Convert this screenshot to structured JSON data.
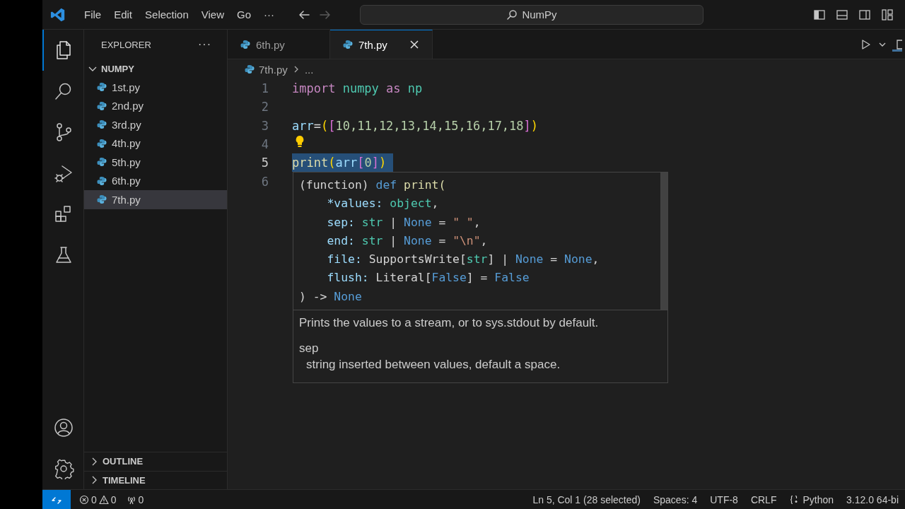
{
  "title_bar": {
    "menu": [
      "File",
      "Edit",
      "Selection",
      "View",
      "Go",
      "···"
    ],
    "nav": [
      {
        "kind": "back",
        "disabled": false
      },
      {
        "kind": "forward",
        "disabled": true
      }
    ],
    "search": "NumPy"
  },
  "activity_bar": {
    "top": [
      {
        "kind": "files",
        "selected": true
      },
      {
        "kind": "search",
        "selected": false
      },
      {
        "kind": "source-control",
        "selected": false
      },
      {
        "kind": "run-debug",
        "selected": false
      },
      {
        "kind": "extensions",
        "selected": false
      },
      {
        "kind": "testing",
        "selected": false
      }
    ],
    "bottom": [
      {
        "kind": "account",
        "selected": false
      },
      {
        "kind": "settings",
        "selected": false
      }
    ]
  },
  "sidebar": {
    "title": "EXPLORER",
    "more": "···",
    "folder": {
      "name": "NUMPY",
      "expanded": true,
      "files": [
        {
          "name": "1st.py",
          "selected": false
        },
        {
          "name": "2nd.py",
          "selected": false
        },
        {
          "name": "3rd.py",
          "selected": false
        },
        {
          "name": "4th.py",
          "selected": false
        },
        {
          "name": "5th.py",
          "selected": false
        },
        {
          "name": "6th.py",
          "selected": false
        },
        {
          "name": "7th.py",
          "selected": true
        }
      ]
    },
    "sections": [
      {
        "name": "OUTLINE",
        "expanded": false
      },
      {
        "name": "TIMELINE",
        "expanded": false
      }
    ]
  },
  "tabs": [
    {
      "label": "6th.py",
      "selected": false
    },
    {
      "label": "7th.py",
      "selected": true
    }
  ],
  "breadcrumb": {
    "file": "7th.py",
    "rest": "..."
  },
  "editor": {
    "lines": [
      {
        "number": "1",
        "current": false,
        "selected": false,
        "lightbulb": false,
        "tokens": [
          {
            "t": "import ",
            "kind": "keyword"
          },
          {
            "t": "numpy ",
            "kind": "module"
          },
          {
            "t": "as ",
            "kind": "keyword"
          },
          {
            "t": "np",
            "kind": "module"
          }
        ]
      },
      {
        "number": "2",
        "current": false,
        "selected": false,
        "lightbulb": false
      },
      {
        "number": "3",
        "current": false,
        "selected": false,
        "lightbulb": false,
        "tokens": [
          {
            "t": "arr",
            "kind": "var"
          },
          {
            "t": "=",
            "kind": "plain"
          },
          {
            "t": "(",
            "kind": "bracket1"
          },
          {
            "t": "[",
            "kind": "bracket2"
          },
          {
            "t": "10,11,12,13,14,15,16,17,18",
            "kind": "number"
          },
          {
            "t": "]",
            "kind": "bracket2"
          },
          {
            "t": ")",
            "kind": "bracket1"
          }
        ]
      },
      {
        "number": "4",
        "current": false,
        "selected": false,
        "lightbulb": true
      },
      {
        "number": "5",
        "current": true,
        "selected": true,
        "lightbulb": false,
        "tokens": [
          {
            "t": "print",
            "kind": "func"
          },
          {
            "t": "(",
            "kind": "bracket1"
          },
          {
            "t": "arr",
            "kind": "var"
          },
          {
            "t": "[",
            "kind": "bracket2"
          },
          {
            "t": "0",
            "kind": "number"
          },
          {
            "t": "]",
            "kind": "bracket2"
          },
          {
            "t": ")",
            "kind": "bracket1"
          }
        ]
      },
      {
        "number": "6",
        "current": false,
        "selected": false,
        "lightbulb": false
      }
    ]
  },
  "hover": {
    "signature": [
      [
        {
          "t": "(function) ",
          "kind": "plain"
        },
        {
          "t": "def ",
          "kind": "def"
        },
        {
          "t": "print(",
          "kind": "func"
        }
      ],
      [
        {
          "t": "    *values: ",
          "kind": "param"
        },
        {
          "t": "object",
          "kind": "module"
        },
        {
          "t": ",",
          "kind": "plain"
        }
      ],
      [
        {
          "t": "    sep: ",
          "kind": "param"
        },
        {
          "t": "str",
          "kind": "module"
        },
        {
          "t": " | ",
          "kind": "plain"
        },
        {
          "t": "None",
          "kind": "def"
        },
        {
          "t": " = ",
          "kind": "plain"
        },
        {
          "t": "\" \"",
          "kind": "string"
        },
        {
          "t": ",",
          "kind": "plain"
        }
      ],
      [
        {
          "t": "    end: ",
          "kind": "param"
        },
        {
          "t": "str",
          "kind": "module"
        },
        {
          "t": " | ",
          "kind": "plain"
        },
        {
          "t": "None",
          "kind": "def"
        },
        {
          "t": " = ",
          "kind": "plain"
        },
        {
          "t": "\"\\n\"",
          "kind": "string"
        },
        {
          "t": ",",
          "kind": "plain"
        }
      ],
      [
        {
          "t": "    file: ",
          "kind": "param"
        },
        {
          "t": "SupportsWrite[",
          "kind": "plain"
        },
        {
          "t": "str",
          "kind": "module"
        },
        {
          "t": "] | ",
          "kind": "plain"
        },
        {
          "t": "None",
          "kind": "def"
        },
        {
          "t": " = ",
          "kind": "plain"
        },
        {
          "t": "None",
          "kind": "def"
        },
        {
          "t": ",",
          "kind": "plain"
        }
      ],
      [
        {
          "t": "    flush: ",
          "kind": "param"
        },
        {
          "t": "Literal[",
          "kind": "plain"
        },
        {
          "t": "False",
          "kind": "def"
        },
        {
          "t": "] = ",
          "kind": "plain"
        },
        {
          "t": "False",
          "kind": "def"
        }
      ],
      [
        {
          "t": ") -> ",
          "kind": "plain"
        },
        {
          "t": "None",
          "kind": "def"
        }
      ]
    ],
    "description": "Prints the values to a stream, or to sys.stdout by default.",
    "param": "sep",
    "param_doc": "string inserted between values, default a space."
  },
  "status_bar": {
    "errors": "0",
    "warnings": "0",
    "ports": "0",
    "items": [
      {
        "text": "Ln 5, Col 1 (28 selected)",
        "kind": "plain"
      },
      {
        "text": "Spaces: 4",
        "kind": "plain"
      },
      {
        "text": "UTF-8",
        "kind": "plain"
      },
      {
        "text": "CRLF",
        "kind": "plain"
      },
      {
        "text": "Python",
        "kind": "language"
      },
      {
        "text": "3.12.0 64-bi",
        "kind": "plain"
      }
    ]
  }
}
